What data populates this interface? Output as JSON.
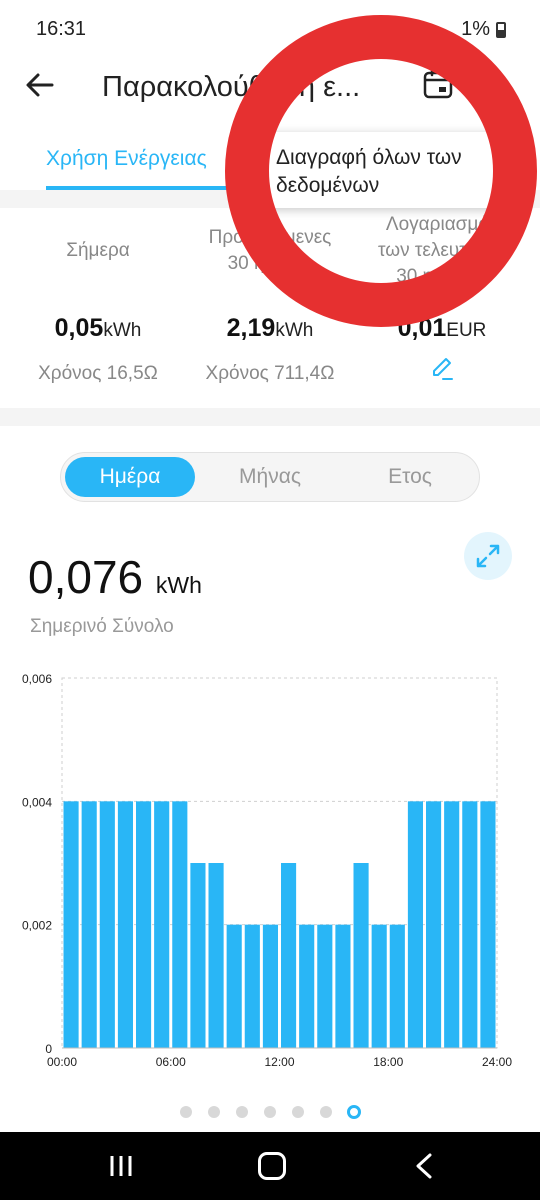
{
  "status_bar": {
    "time": "16:31",
    "battery": "1%"
  },
  "app_bar": {
    "title": "Παρακολούθηση ε..."
  },
  "tabs": {
    "active": "Χρήση Ενέργειας"
  },
  "popup_menu": {
    "delete_all": "Διαγραφή όλων των\nδεδομένων"
  },
  "summary": {
    "today": {
      "label": "Σήμερα",
      "value": "0,05",
      "unit": "kWh",
      "year": "Χρόνος 16,5Ω"
    },
    "last30": {
      "label": "Προηγούμενες\n30 ημέρες",
      "value": "2,19",
      "unit": "kWh",
      "year": "Χρόνος 711,4Ω"
    },
    "bill": {
      "label": "Λογαριασμός\nτων τελευταίων\n30 ημερών",
      "value": "0,01",
      "unit": "EUR"
    }
  },
  "segments": {
    "day": "Ημέρα",
    "month": "Μήνας",
    "year": "Ετος",
    "selected": "day"
  },
  "total": {
    "value": "0,076",
    "unit": "kWh",
    "label": "Σημερινό Σύνολο"
  },
  "chart_data": {
    "type": "bar",
    "x_ticks": [
      "00:00",
      "06:00",
      "12:00",
      "18:00",
      "24:00"
    ],
    "y_ticks": [
      "0",
      "0,002",
      "0,004",
      "0,006"
    ],
    "ylim": [
      0,
      0.006
    ],
    "xlim": [
      0,
      24
    ],
    "categories": [
      "0",
      "1",
      "2",
      "3",
      "4",
      "5",
      "6",
      "7",
      "8",
      "9",
      "10",
      "11",
      "12",
      "13",
      "14",
      "15",
      "16",
      "17",
      "18",
      "19",
      "20",
      "21",
      "22",
      "23"
    ],
    "values": [
      0.004,
      0.004,
      0.004,
      0.004,
      0.004,
      0.004,
      0.004,
      0.003,
      0.003,
      0.002,
      0.002,
      0.002,
      0.003,
      0.002,
      0.002,
      0.002,
      0.003,
      0.002,
      0.002,
      0.004,
      0.004,
      0.004,
      0.004,
      0.004
    ],
    "bar_color": "#29b6f6",
    "grid": true
  },
  "pager": {
    "count": 7,
    "active": 6
  },
  "colors": {
    "accent": "#29b6f6",
    "annotation": "#e63030"
  }
}
